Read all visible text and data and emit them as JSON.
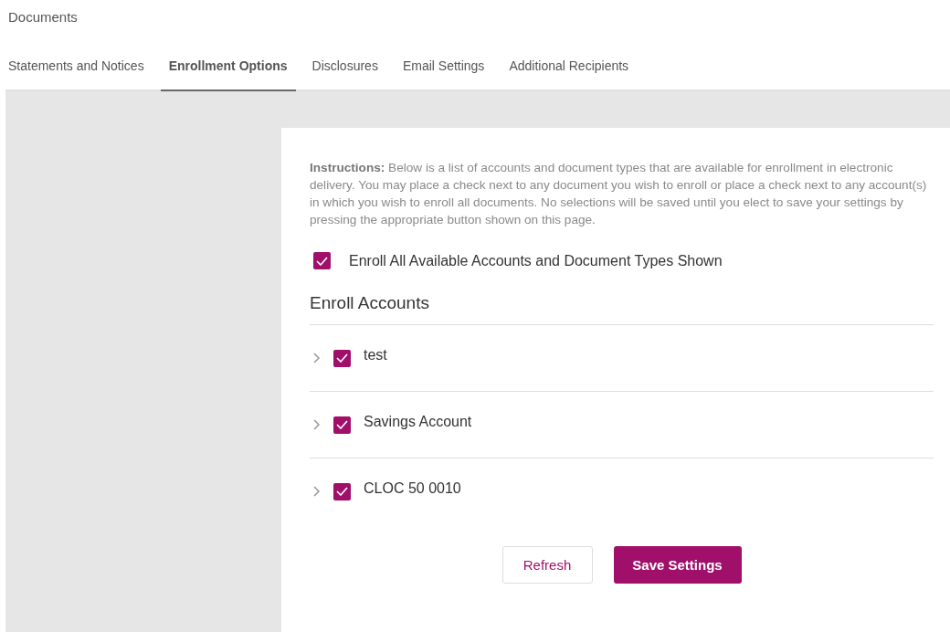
{
  "page": {
    "title": "Documents"
  },
  "tabs": [
    {
      "label": "Statements and Notices",
      "selected": false
    },
    {
      "label": "Enrollment Options",
      "selected": true
    },
    {
      "label": "Disclosures",
      "selected": false
    },
    {
      "label": "Email Settings",
      "selected": false
    },
    {
      "label": "Additional Recipients",
      "selected": false
    }
  ],
  "instructions": "**Instructions:** Below is a list of accounts and document types that are available for enrollment in electronic delivery. You may place a check next to any document you wish to enroll or place a check next to any account(s) in which you wish to enroll all documents. No selections will be saved until you elect to save your settings by pressing the appropriate button shown on this page.",
  "enroll_all": {
    "label": "Enroll All Available Accounts and Document Types Shown",
    "checked": true
  },
  "accounts_heading": "Enroll Accounts",
  "accounts": [
    {
      "name": "test",
      "checked": true,
      "expanded": false
    },
    {
      "name": "Savings Account",
      "checked": true,
      "expanded": false
    },
    {
      "name": "CLOC 50 0010",
      "checked": true,
      "expanded": false
    }
  ],
  "buttons": [
    {
      "label": "Refresh",
      "kind": "secondary"
    },
    {
      "label": "Save Settings",
      "kind": "primary"
    }
  ]
}
